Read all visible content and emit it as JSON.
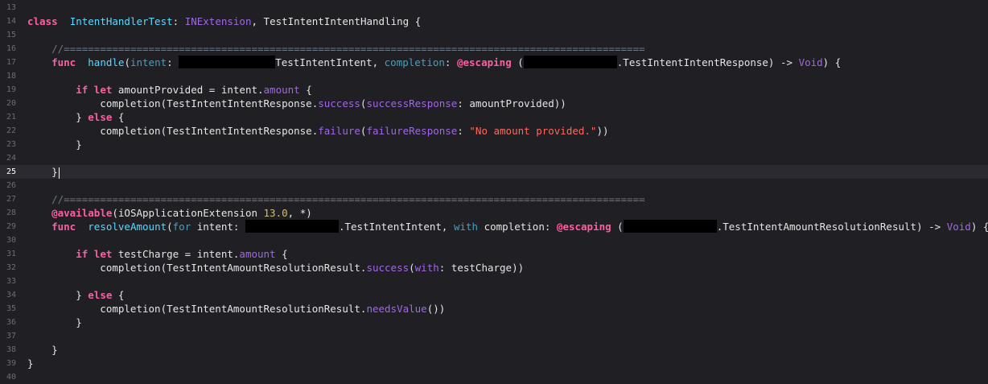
{
  "editor": {
    "comment_sep": "//================================================================================================",
    "lines": [
      {
        "n": "13"
      },
      {
        "n": "14",
        "p": [
          [
            "kw",
            "class"
          ],
          [
            "",
            "  "
          ],
          [
            "type",
            "IntentHandlerTest"
          ],
          [
            "",
            ": "
          ],
          [
            "proj",
            "INExtension"
          ],
          [
            "",
            ", TestIntentIntentHandling {"
          ]
        ]
      },
      {
        "n": "15"
      },
      {
        "n": "16",
        "p": [
          [
            "",
            "    "
          ],
          [
            "cmt",
            "//================================================================================================"
          ]
        ]
      },
      {
        "n": "17",
        "p": [
          [
            "",
            "    "
          ],
          [
            "kw",
            "func"
          ],
          [
            "",
            "  "
          ],
          [
            "type",
            "handle"
          ],
          [
            "",
            "("
          ],
          [
            "param",
            "intent"
          ],
          [
            "",
            ": "
          ],
          [
            "redact",
            "120"
          ],
          [
            "",
            "TestIntentIntent, "
          ],
          [
            "param",
            "completion"
          ],
          [
            "",
            ": "
          ],
          [
            "kw",
            "@escaping"
          ],
          [
            "",
            " ("
          ],
          [
            "redact",
            "116"
          ],
          [
            "",
            ".TestIntentIntentResponse) -> "
          ],
          [
            "proj",
            "Void"
          ],
          [
            "",
            ") {"
          ]
        ]
      },
      {
        "n": "18"
      },
      {
        "n": "19",
        "p": [
          [
            "",
            "        "
          ],
          [
            "kw",
            "if let"
          ],
          [
            "",
            " amountProvided = intent."
          ],
          [
            "proj",
            "amount"
          ],
          [
            "",
            " {"
          ]
        ]
      },
      {
        "n": "20",
        "p": [
          [
            "",
            "            completion(TestIntentIntentResponse."
          ],
          [
            "proj",
            "success"
          ],
          [
            "",
            "("
          ],
          [
            "proj",
            "successResponse"
          ],
          [
            "",
            ": amountProvided))"
          ]
        ]
      },
      {
        "n": "21",
        "p": [
          [
            "",
            "        } "
          ],
          [
            "kw",
            "else"
          ],
          [
            "",
            " {"
          ]
        ]
      },
      {
        "n": "22",
        "p": [
          [
            "",
            "            completion(TestIntentIntentResponse."
          ],
          [
            "proj",
            "failure"
          ],
          [
            "",
            "("
          ],
          [
            "proj",
            "failureResponse"
          ],
          [
            "",
            ": "
          ],
          [
            "str",
            "\"No amount provided.\""
          ],
          [
            "",
            "))"
          ]
        ]
      },
      {
        "n": "23",
        "p": [
          [
            "",
            "        }"
          ]
        ]
      },
      {
        "n": "24"
      },
      {
        "n": "25",
        "active": true,
        "p": [
          [
            "",
            "    }"
          ],
          [
            "cursor",
            ""
          ]
        ]
      },
      {
        "n": "26"
      },
      {
        "n": "27",
        "p": [
          [
            "",
            "    "
          ],
          [
            "cmt",
            "//================================================================================================"
          ]
        ]
      },
      {
        "n": "28",
        "p": [
          [
            "",
            "    "
          ],
          [
            "kw",
            "@available"
          ],
          [
            "",
            "(iOSApplicationExtension "
          ],
          [
            "num",
            "13.0"
          ],
          [
            "",
            ", *)"
          ]
        ]
      },
      {
        "n": "29",
        "p": [
          [
            "",
            "    "
          ],
          [
            "kw",
            "func"
          ],
          [
            "",
            "  "
          ],
          [
            "type",
            "resolveAmount"
          ],
          [
            "",
            "("
          ],
          [
            "param",
            "for"
          ],
          [
            "",
            " intent: "
          ],
          [
            "redact",
            "116"
          ],
          [
            "",
            ".TestIntentIntent, "
          ],
          [
            "param",
            "with"
          ],
          [
            "",
            " completion: "
          ],
          [
            "kw",
            "@escaping"
          ],
          [
            "",
            " ("
          ],
          [
            "redact",
            "116"
          ],
          [
            "",
            ".TestIntentAmountResolutionResult) -> "
          ],
          [
            "proj",
            "Void"
          ],
          [
            "",
            ") {"
          ]
        ]
      },
      {
        "n": "30"
      },
      {
        "n": "31",
        "p": [
          [
            "",
            "        "
          ],
          [
            "kw",
            "if let"
          ],
          [
            "",
            " testCharge = intent."
          ],
          [
            "proj",
            "amount"
          ],
          [
            "",
            " {"
          ]
        ]
      },
      {
        "n": "32",
        "p": [
          [
            "",
            "            completion(TestIntentAmountResolutionResult."
          ],
          [
            "proj",
            "success"
          ],
          [
            "",
            "("
          ],
          [
            "proj",
            "with"
          ],
          [
            "",
            ": testCharge))"
          ]
        ]
      },
      {
        "n": "33"
      },
      {
        "n": "34",
        "p": [
          [
            "",
            "        } "
          ],
          [
            "kw",
            "else"
          ],
          [
            "",
            " {"
          ]
        ]
      },
      {
        "n": "35",
        "p": [
          [
            "",
            "            completion(TestIntentAmountResolutionResult."
          ],
          [
            "proj",
            "needsValue"
          ],
          [
            "",
            "())"
          ]
        ]
      },
      {
        "n": "36",
        "p": [
          [
            "",
            "        }"
          ]
        ]
      },
      {
        "n": "37"
      },
      {
        "n": "38",
        "p": [
          [
            "",
            "    }"
          ]
        ]
      },
      {
        "n": "39",
        "p": [
          [
            "",
            "}"
          ]
        ]
      },
      {
        "n": "40"
      }
    ]
  }
}
